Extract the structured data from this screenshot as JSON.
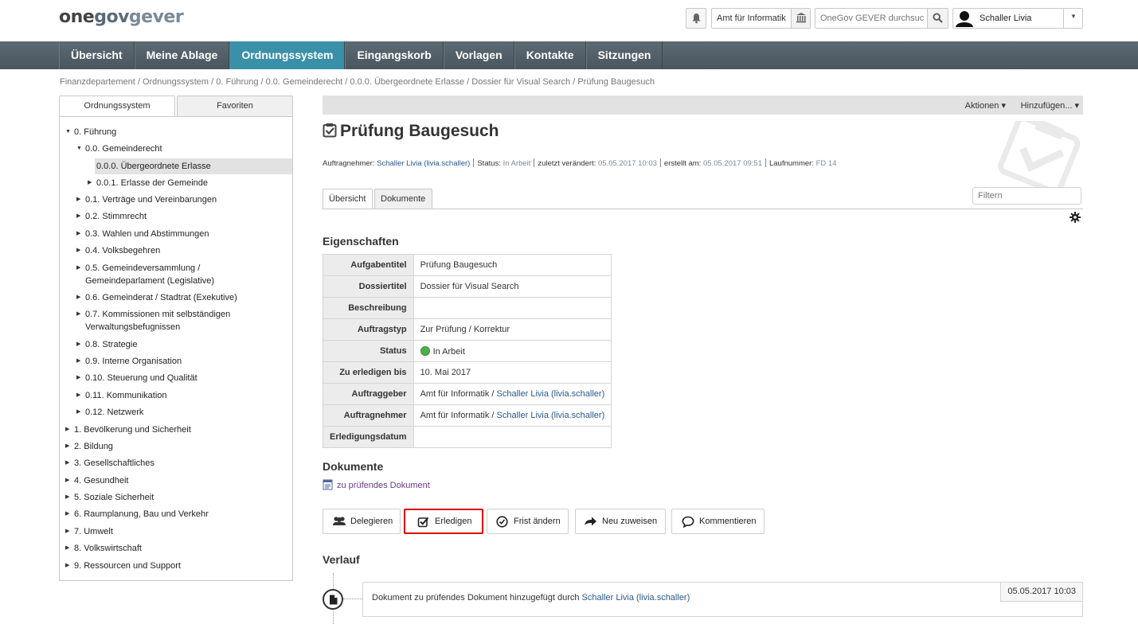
{
  "logo": {
    "one": "one",
    "gov": "gov",
    "gever": "gever"
  },
  "header": {
    "org_label": "Amt für Informatik",
    "search_placeholder": "OneGov GEVER durchsuc",
    "user_name": "Schaller Livia"
  },
  "nav": [
    "Übersicht",
    "Meine Ablage",
    "Ordnungssystem",
    "Eingangskorb",
    "Vorlagen",
    "Kontakte",
    "Sitzungen"
  ],
  "breadcrumb": "Finanzdepartement / Ordnungssystem / 0. Führung / 0.0. Gemeinderecht / 0.0.0. Übergeordnete Erlasse / Dossier für Visual Search / Prüfung Baugesuch",
  "sidebar": {
    "tabs": [
      "Ordnungssystem",
      "Favoriten"
    ],
    "tree": [
      "0. Führung",
      "0.0. Gemeinderecht",
      "0.0.0. Übergeordnete Erlasse",
      "0.0.1. Erlasse der Gemeinde",
      "0.1. Verträge und Vereinbarungen",
      "0.2. Stimmrecht",
      "0.3. Wahlen und Abstimmungen",
      "0.4. Volksbegehren",
      "0.5. Gemeindeversammlung /",
      "Gemeindeparlament (Legislative)",
      "0.6. Gemeinderat / Stadtrat (Exekutive)",
      "0.7. Kommissionen mit selbständigen",
      "Verwaltungsbefugnissen",
      "0.8. Strategie",
      "0.9. Interne Organisation",
      "0.10. Steuerung und Qualität",
      "0.11. Kommunikation",
      "0.12. Netzwerk",
      "1. Bevölkerung und Sicherheit",
      "2. Bildung",
      "3. Gesellschaftliches",
      "4. Gesundheit",
      "5. Soziale Sicherheit",
      "6. Raumplanung, Bau und Verkehr",
      "7. Umwelt",
      "8. Volkswirtschaft",
      "9. Ressourcen und Support"
    ]
  },
  "actions": {
    "aktionen": "Aktionen ▾",
    "hinzufuegen": "Hinzufügen... ▾"
  },
  "task": {
    "title": "Prüfung Baugesuch",
    "meta": {
      "auftragnehmer_label": "Auftragnehmer:",
      "auftragnehmer": "Schaller Livia (livia.schaller)",
      "status_label": "Status:",
      "status": "In Arbeit",
      "changed_label": "zuletzt verändert:",
      "changed": "05.05.2017 10:03",
      "created_label": "erstellt am:",
      "created": "05.05.2017 09:51",
      "nr_label": "Laufnummer:",
      "nr": "FD 14"
    }
  },
  "content_tabs": [
    "Übersicht",
    "Dokumente"
  ],
  "filter_placeholder": "Filtern",
  "sections": {
    "properties": "Eigenschaften",
    "documents": "Dokumente",
    "history": "Verlauf"
  },
  "properties": [
    {
      "k": "Aufgabentitel",
      "v": "Prüfung Baugesuch"
    },
    {
      "k": "Dossiertitel",
      "v": "Dossier für Visual Search"
    },
    {
      "k": "Beschreibung",
      "v": ""
    },
    {
      "k": "Auftragstyp",
      "v": "Zur Prüfung / Korrektur"
    },
    {
      "k": "Status",
      "v": "In Arbeit"
    },
    {
      "k": "Zu erledigen bis",
      "v": "10. Mai 2017"
    },
    {
      "k": "Auftraggeber",
      "v": "Amt für Informatik / ",
      "link": "Schaller Livia (livia.schaller)"
    },
    {
      "k": "Auftragnehmer",
      "v": "Amt für Informatik / ",
      "link": "Schaller Livia (livia.schaller)"
    },
    {
      "k": "Erledigungsdatum",
      "v": ""
    }
  ],
  "document_link": "zu prüfendes Dokument",
  "buttons": [
    "Delegieren",
    "Erledigen",
    "Frist ändern",
    "Neu zuweisen",
    "Kommentieren"
  ],
  "history": {
    "text": "Dokument zu prüfendes Dokument hinzugefügt durch ",
    "link": "Schaller Livia (livia.schaller)",
    "date": "05.05.2017 10:03"
  }
}
